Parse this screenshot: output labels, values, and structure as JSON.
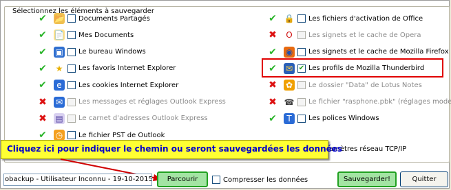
{
  "group_title": "Sélectionnez les éléments à sauvegarder",
  "left_items": [
    {
      "status": "ok",
      "icon": "folder-icon",
      "checked": false,
      "enabled": true,
      "label": "Documents Partagés"
    },
    {
      "status": "ok",
      "icon": "my-documents-icon",
      "checked": false,
      "enabled": true,
      "label": "Mes Documents"
    },
    {
      "status": "ok",
      "icon": "windows-desktop-icon",
      "checked": false,
      "enabled": true,
      "label": "Le bureau Windows"
    },
    {
      "status": "ok",
      "icon": "star-favorites-icon",
      "checked": false,
      "enabled": true,
      "label": "Les favoris Internet Explorer"
    },
    {
      "status": "ok",
      "icon": "internet-explorer-icon",
      "checked": false,
      "enabled": true,
      "label": "Les cookies Internet Explorer"
    },
    {
      "status": "no",
      "icon": "outlook-express-icon",
      "checked": false,
      "enabled": false,
      "label": "Les messages et réglages Outlook Express"
    },
    {
      "status": "no",
      "icon": "address-book-icon",
      "checked": false,
      "enabled": false,
      "label": "Le carnet d'adresses Outlook Express"
    },
    {
      "status": "ok",
      "icon": "outlook-pst-icon",
      "checked": false,
      "enabled": true,
      "label": "Le fichier PST de Outlook"
    }
  ],
  "right_items": [
    {
      "status": "ok",
      "icon": "lock-icon",
      "checked": false,
      "enabled": true,
      "label": "Les fichiers d'activation de Office"
    },
    {
      "status": "no",
      "icon": "opera-icon",
      "checked": false,
      "enabled": false,
      "label": "Les signets et le cache de Opera"
    },
    {
      "status": "ok",
      "icon": "firefox-icon",
      "checked": false,
      "enabled": true,
      "label": "Les signets et le cache de Mozilla Firefox"
    },
    {
      "status": "ok",
      "icon": "thunderbird-icon",
      "checked": true,
      "enabled": true,
      "label": "Les profils de Mozilla Thunderbird"
    },
    {
      "status": "no",
      "icon": "lotus-notes-icon",
      "checked": false,
      "enabled": false,
      "label": "Le dossier \"Data\" de Lotus Notes"
    },
    {
      "status": "no",
      "icon": "phone-icon",
      "checked": false,
      "enabled": false,
      "label": "Le fichier \"rasphone.pbk\" (réglages modem)"
    },
    {
      "status": "ok",
      "icon": "fonts-icon",
      "checked": false,
      "enabled": true,
      "label": "Les polices Windows"
    }
  ],
  "partial_label": "amètres réseau TCP/IP",
  "callout_text": "Cliquez ici pour indiquer le chemin ou seront sauvegardées les données",
  "path_value": "obackup - Utilisateur Inconnu - 19-10-2015\\",
  "browse_label": "Parcourir",
  "compress_label": "Compresser les données",
  "save_label": "Sauvegarder!",
  "quit_label": "Quitter",
  "colors": {
    "ok": "#28b428",
    "no": "#dd1111",
    "highlight": "#e00000",
    "callout_bg": "#ffff33",
    "callout_text": "#0000cc",
    "green_button": "#a3e4a3"
  }
}
